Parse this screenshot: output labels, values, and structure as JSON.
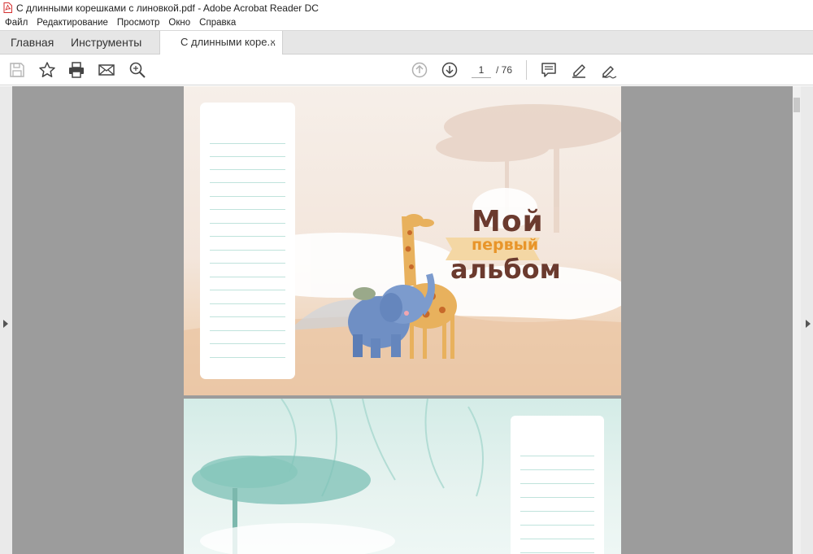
{
  "window": {
    "title": "С длинными корешками с линовкой.pdf - Adobe Acrobat Reader DC"
  },
  "menu": [
    "Файл",
    "Редактирование",
    "Просмотр",
    "Окно",
    "Справка"
  ],
  "tabs": {
    "home": "Главная",
    "tools": "Инструменты",
    "document": "С длинными коре...",
    "close": "×"
  },
  "toolbar": {
    "page_current": "1",
    "page_total": "/ 76"
  },
  "icons": {
    "save": "save-icon",
    "bookmark": "star-icon",
    "print": "printer-icon",
    "email": "mail-icon",
    "search": "zoom-search-icon",
    "prev": "arrow-up-icon",
    "next": "arrow-down-icon",
    "comment": "comment-icon",
    "highlight": "pen-icon",
    "sign": "signature-icon"
  },
  "document": {
    "page1": {
      "title_line1": "Мой",
      "title_line2": "первый",
      "title_line3": "альбом"
    }
  },
  "colors": {
    "accent_brown": "#6b3a2e",
    "accent_orange": "#e8952a",
    "lines": "#bfe3dc",
    "workarea": "#9c9c9c"
  }
}
